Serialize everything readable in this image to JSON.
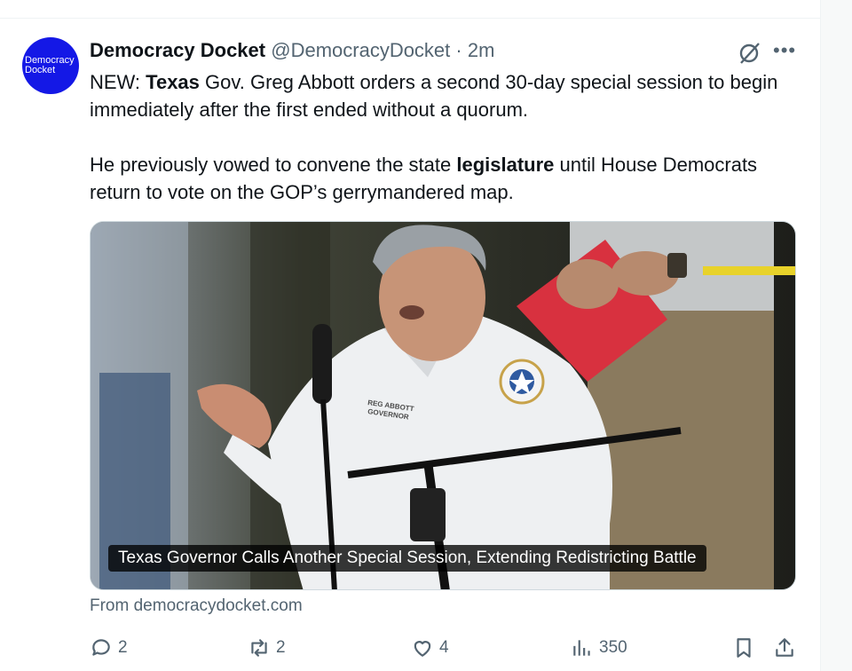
{
  "tweet": {
    "avatar": {
      "line1": "Democracy",
      "line2": "Docket"
    },
    "author_name": "Democracy Docket",
    "handle": "@DemocracyDocket",
    "separator": "·",
    "time": "2m",
    "more_label": "•••",
    "paragraph1": {
      "before": "NEW: ",
      "bold": "Texas",
      "after": " Gov. Greg Abbott orders a second 30-day special session to begin immediately after the first ended without a quorum."
    },
    "paragraph2": {
      "before": "He previously vowed to convene the state ",
      "bold": "legislature",
      "after": " until House Democrats return to vote on the GOP’s gerrymandered map."
    },
    "link_card": {
      "headline": "Texas Governor Calls Another Special Session, Extending Redistricting Battle",
      "source": "From democracydocket.com",
      "shirt_text_line1": "REG ABBOTT",
      "shirt_text_line2": "GOVERNOR"
    },
    "actions": {
      "replies": "2",
      "reposts": "2",
      "likes": "4",
      "views": "350"
    },
    "icons": {
      "grok": "grok-icon",
      "reply": "reply-icon",
      "repost": "repost-icon",
      "like": "heart-icon",
      "views": "views-icon",
      "bookmark": "bookmark-icon",
      "share": "share-icon"
    },
    "colors": {
      "avatar_bg": "#1418e6",
      "text_primary": "#0f1419",
      "text_secondary": "#536471"
    }
  }
}
